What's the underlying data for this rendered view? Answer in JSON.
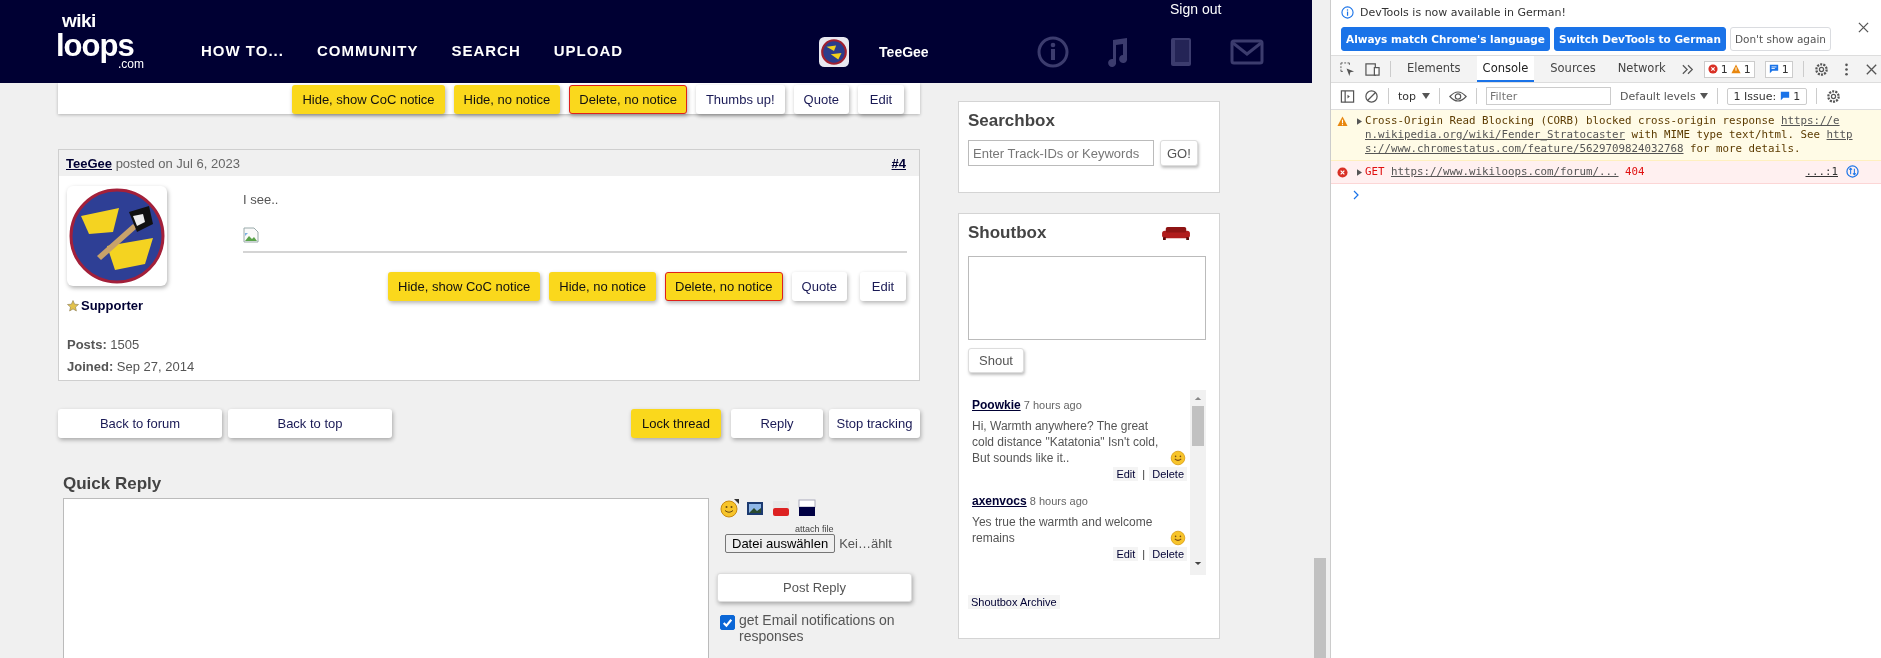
{
  "header": {
    "logo": {
      "top": "wiki",
      "main": "loops",
      "sub": ".com"
    },
    "nav": [
      {
        "label": "HOW TO..."
      },
      {
        "label": "COMMUNITY"
      },
      {
        "label": "SEARCH"
      },
      {
        "label": "UPLOAD"
      }
    ],
    "user": "TeeGee",
    "sign_out": "Sign out"
  },
  "previous_post": {
    "buttons": [
      {
        "label": "Hide, show CoC notice",
        "kind": "moderate"
      },
      {
        "label": "Hide, no notice",
        "kind": "moderate"
      },
      {
        "label": "Delete, no notice",
        "kind": "delete"
      },
      {
        "label": "Thumbs up!",
        "kind": "plain"
      },
      {
        "label": "Quote",
        "kind": "plain"
      },
      {
        "label": "Edit",
        "kind": "plain"
      }
    ]
  },
  "post": {
    "author": "TeeGee",
    "posted": "posted on Jul 6, 2023",
    "number": "#4",
    "rank": "Supporter",
    "stats": [
      {
        "label": "Posts:",
        "value": "1505"
      },
      {
        "label": "Joined:",
        "value": "Sep 27, 2014"
      }
    ],
    "text": "I see..",
    "buttons": [
      {
        "label": "Hide, show CoC notice",
        "kind": "moderate"
      },
      {
        "label": "Hide, no notice",
        "kind": "moderate"
      },
      {
        "label": "Delete, no notice",
        "kind": "delete"
      },
      {
        "label": "Quote",
        "kind": "plain"
      },
      {
        "label": "Edit",
        "kind": "plain"
      }
    ]
  },
  "thread_buttons": [
    {
      "label": "Back to forum",
      "kind": "plain"
    },
    {
      "label": "Back to top",
      "kind": "plain"
    },
    {
      "label": "Lock thread",
      "kind": "moderate"
    },
    {
      "label": "Reply",
      "kind": "plain"
    },
    {
      "label": "Stop tracking",
      "kind": "plain"
    }
  ],
  "quick_reply": {
    "title": "Quick Reply",
    "attach_label": "attach file",
    "file_button": "Datei auswählen",
    "file_status": "Kei…ählt",
    "submit": "Post Reply",
    "notify": {
      "label": "get Email notifications on responses",
      "checked": true
    }
  },
  "searchbox": {
    "title": "Searchbox",
    "placeholder": "Enter Track-IDs or Keywords",
    "button": "GO!"
  },
  "shoutbox": {
    "title": "Shoutbox",
    "button": "Shout",
    "shouts": [
      {
        "user": "Poowkie",
        "time": "7 hours ago",
        "text": "Hi, Warmth anywhere? The great cold distance \"Katatonia\" Isn't cold, But sounds like it..",
        "actions": [
          "Edit",
          "Delete"
        ],
        "separator": "|"
      },
      {
        "user": "axenvocs",
        "time": "8 hours ago",
        "text": "Yes true the warmth and welcome remains",
        "actions": [
          "Edit",
          "Delete"
        ],
        "separator": "|"
      }
    ],
    "archive": "Shoutbox Archive"
  },
  "devtools": {
    "banner": {
      "message": "DevTools is now available in German!",
      "buttons": [
        {
          "label": "Always match Chrome's language",
          "kind": "primary"
        },
        {
          "label": "Switch DevTools to German",
          "kind": "primary"
        },
        {
          "label": "Don't show again",
          "kind": "secondary"
        }
      ]
    },
    "tabs": [
      {
        "label": "Elements",
        "selected": false
      },
      {
        "label": "Console",
        "selected": true
      },
      {
        "label": "Sources",
        "selected": false
      },
      {
        "label": "Network",
        "selected": false
      }
    ],
    "counts": {
      "errors": "1",
      "warnings": "1",
      "messages": "1"
    },
    "toolbar": {
      "context": "top",
      "filter_placeholder": "Filter",
      "levels": "Default levels",
      "issues_label": "1 Issue:",
      "issues_count": "1"
    },
    "messages": [
      {
        "kind": "warning",
        "lines": [
          [
            {
              "text": "Cross-Origin Read Blocking (CORB) blocked cross-origin response "
            },
            {
              "text": "https://e",
              "link": true
            }
          ],
          [
            {
              "text": "n.wikipedia.org/wiki/Fender_Stratocaster",
              "link": true
            },
            {
              "text": " with MIME type text/html. See "
            },
            {
              "text": "http",
              "link": true
            }
          ],
          [
            {
              "text": "s://www.chromestatus.com/feature/5629709824032768",
              "link": true
            },
            {
              "text": " for more details."
            }
          ]
        ]
      },
      {
        "kind": "error",
        "lines": [
          [
            {
              "text": "GET "
            },
            {
              "text": "https://www.wikiloops.com/forum/...",
              "link": true
            },
            {
              "text": " 404"
            }
          ]
        ],
        "source": "...:1"
      }
    ]
  }
}
